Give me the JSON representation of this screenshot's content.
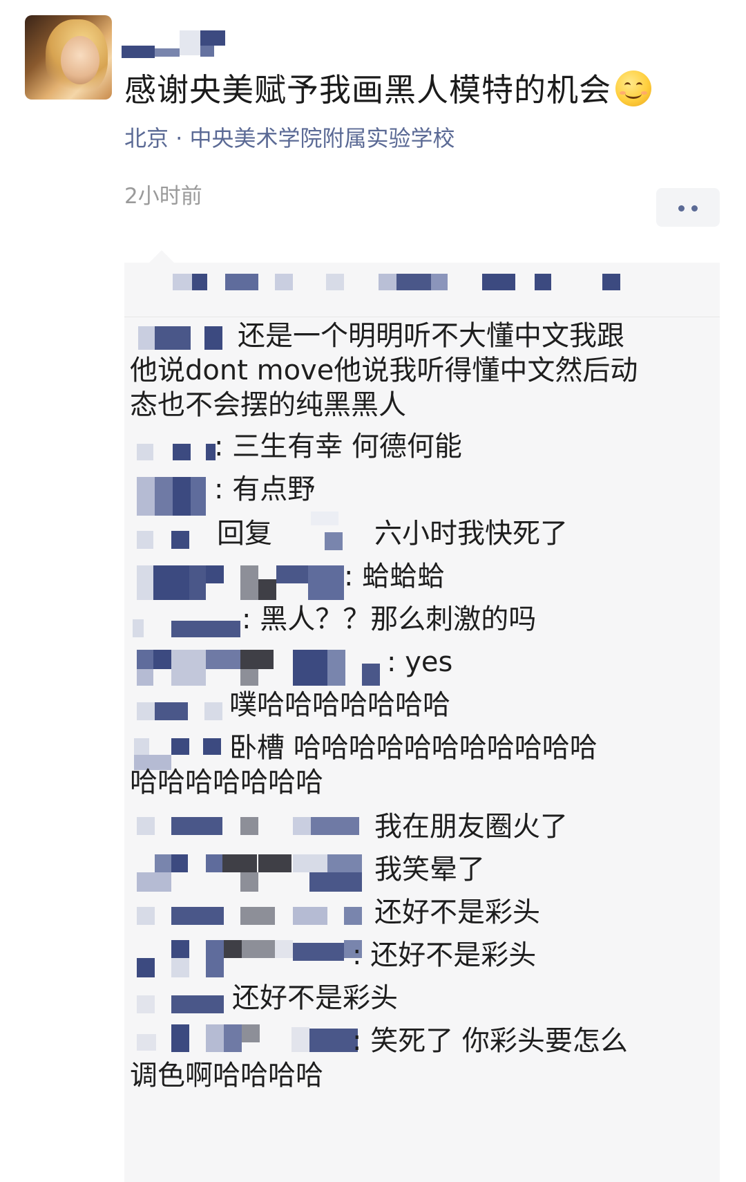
{
  "post": {
    "text": "感谢央美赋予我画黑人模特的机会",
    "emoji": "smile-emoji",
    "location": "北京 · 中央美术学院附属实验学校",
    "time": "2小时前"
  },
  "comments": [
    {
      "text": "还是一个明明听不大懂中文我跟"
    },
    {
      "text": "他说dont move他说我听得懂中文然后动"
    },
    {
      "text": "态也不会摆的纯黑黑人"
    },
    {
      "text": ": 三生有幸 何德何能"
    },
    {
      "text": ": 有点野"
    },
    {
      "text": "回复"
    },
    {
      "text": "六小时我快死了"
    },
    {
      "text": ": 蛤蛤蛤"
    },
    {
      "text": ": 黑人？？那么刺激的吗"
    },
    {
      "text": ": yes"
    },
    {
      "text": "噗哈哈哈哈哈哈哈"
    },
    {
      "text": "卧槽 哈哈哈哈哈哈哈哈哈哈哈"
    },
    {
      "text": "哈哈哈哈哈哈哈"
    },
    {
      "text": "我在朋友圈火了"
    },
    {
      "text": "我笑晕了"
    },
    {
      "text": "还好不是彩头"
    },
    {
      "text": ": 还好不是彩头"
    },
    {
      "text": "还好不是彩头"
    },
    {
      "text": ": 笑死了 你彩头要怎么"
    },
    {
      "text": "调色啊哈哈哈哈"
    }
  ],
  "colors": {
    "name_blue": "#5b6a95",
    "gray_text": "#9a9a9a",
    "box_bg": "#f6f6f7"
  }
}
